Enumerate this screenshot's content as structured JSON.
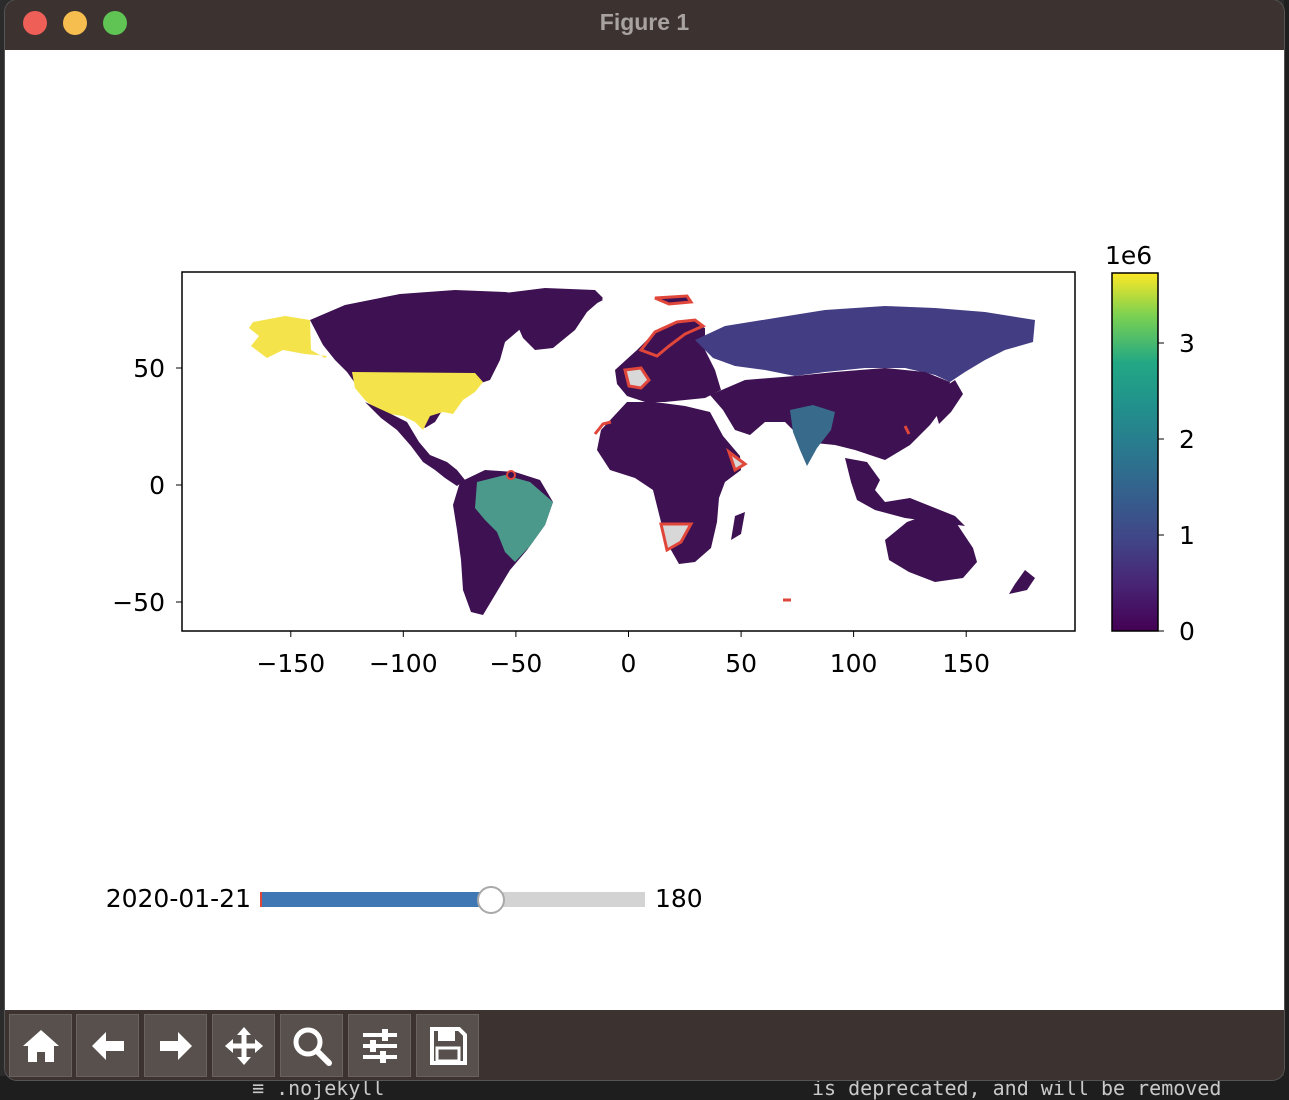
{
  "window": {
    "title": "Figure 1"
  },
  "background": {
    "left_text": "≡ .nojekyll",
    "right_text": "is deprecated, and will be removed"
  },
  "colors": {
    "titlebar": "#3c3331",
    "close": "#ee5f58",
    "minimize": "#f6be4f",
    "maximize": "#5fc453",
    "slider_fill": "#3f76b4",
    "slider_track": "#d3d3d3",
    "highlight_edge": "#e0463a"
  },
  "chart_data": {
    "type": "choropleth",
    "xlabel": "",
    "ylabel": "",
    "xlim": [
      -198,
      198
    ],
    "ylim": [
      -65,
      90
    ],
    "xticks": [
      -150,
      -100,
      -50,
      0,
      50,
      100,
      150
    ],
    "xtick_labels": [
      "−150",
      "−100",
      "−50",
      "0",
      "50",
      "100",
      "150"
    ],
    "yticks": [
      -50,
      0,
      50
    ],
    "ytick_labels": [
      "−50",
      "0",
      "50"
    ],
    "colorbar": {
      "cmap": "viridis",
      "range": [
        0,
        3750000
      ],
      "ticks": [
        0,
        1,
        2,
        3
      ],
      "tick_labels": [
        "0",
        "1",
        "2",
        "3"
      ],
      "offset_label": "1e6"
    },
    "regions": [
      {
        "name": "United States",
        "color": "#f4e34a",
        "value_1e6": 3.7
      },
      {
        "name": "Brazil",
        "color": "#4a998a",
        "value_1e6": 1.9
      },
      {
        "name": "India",
        "color": "#386a8c",
        "value_1e6": 1.0
      },
      {
        "name": "Russia",
        "color": "#433d84",
        "value_1e6": 0.75
      },
      {
        "name": "Rest of world",
        "color": "#3d1152",
        "value_1e6": 0.1
      }
    ]
  },
  "slider": {
    "label": "2020-01-21",
    "value_text": "180",
    "fraction": 0.6
  },
  "toolbar": {
    "buttons": [
      {
        "name": "home-button",
        "icon": "home-icon"
      },
      {
        "name": "back-button",
        "icon": "arrow-left-icon"
      },
      {
        "name": "forward-button",
        "icon": "arrow-right-icon"
      },
      {
        "name": "pan-button",
        "icon": "move-icon"
      },
      {
        "name": "zoom-button",
        "icon": "magnifier-icon"
      },
      {
        "name": "configure-subplots-button",
        "icon": "sliders-icon"
      },
      {
        "name": "save-button",
        "icon": "floppy-disk-icon"
      }
    ]
  }
}
